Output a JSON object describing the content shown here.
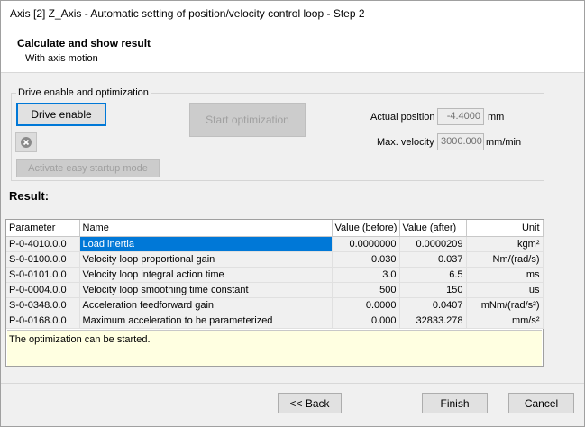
{
  "window": {
    "title": "Axis [2] Z_Axis - Automatic setting of position/velocity control loop - Step 2"
  },
  "header": {
    "step_title": "Calculate and show result",
    "subtitle": "With axis motion"
  },
  "drive_group": {
    "legend": "Drive enable and optimization",
    "drive_enable_label": "Drive enable",
    "start_optimization_label": "Start optimization",
    "activate_easy_startup_label": "Activate easy startup mode",
    "reset_icon": "error-clear-icon",
    "actual_position_label": "Actual position",
    "actual_position_value": "-4.4000",
    "actual_position_unit": "mm",
    "max_velocity_label": "Max. velocity",
    "max_velocity_value": "3000.000",
    "max_velocity_unit": "mm/min"
  },
  "result": {
    "title": "Result:",
    "columns": [
      "Parameter",
      "Name",
      "Value (before)",
      "Value (after)",
      "Unit"
    ],
    "rows": [
      {
        "param": "P-0-4010.0.0",
        "name": "Load inertia",
        "before": "0.0000000",
        "after": "0.0000209",
        "unit": "kgm²"
      },
      {
        "param": "S-0-0100.0.0",
        "name": "Velocity loop proportional gain",
        "before": "0.030",
        "after": "0.037",
        "unit": "Nm/(rad/s)"
      },
      {
        "param": "S-0-0101.0.0",
        "name": "Velocity loop integral action time",
        "before": "3.0",
        "after": "6.5",
        "unit": "ms"
      },
      {
        "param": "P-0-0004.0.0",
        "name": "Velocity loop smoothing time constant",
        "before": "500",
        "after": "150",
        "unit": "us"
      },
      {
        "param": "S-0-0348.0.0",
        "name": "Acceleration feedforward gain",
        "before": "0.0000",
        "after": "0.0407",
        "unit": "mNm/(rad/s²)"
      },
      {
        "param": "P-0-0168.0.0",
        "name": "Maximum acceleration to be parameterized",
        "before": "0.000",
        "after": "32833.278",
        "unit": "mm/s²"
      }
    ],
    "status_message": "The optimization can be started."
  },
  "footer": {
    "back_label": "<< Back",
    "finish_label": "Finish",
    "cancel_label": "Cancel"
  }
}
